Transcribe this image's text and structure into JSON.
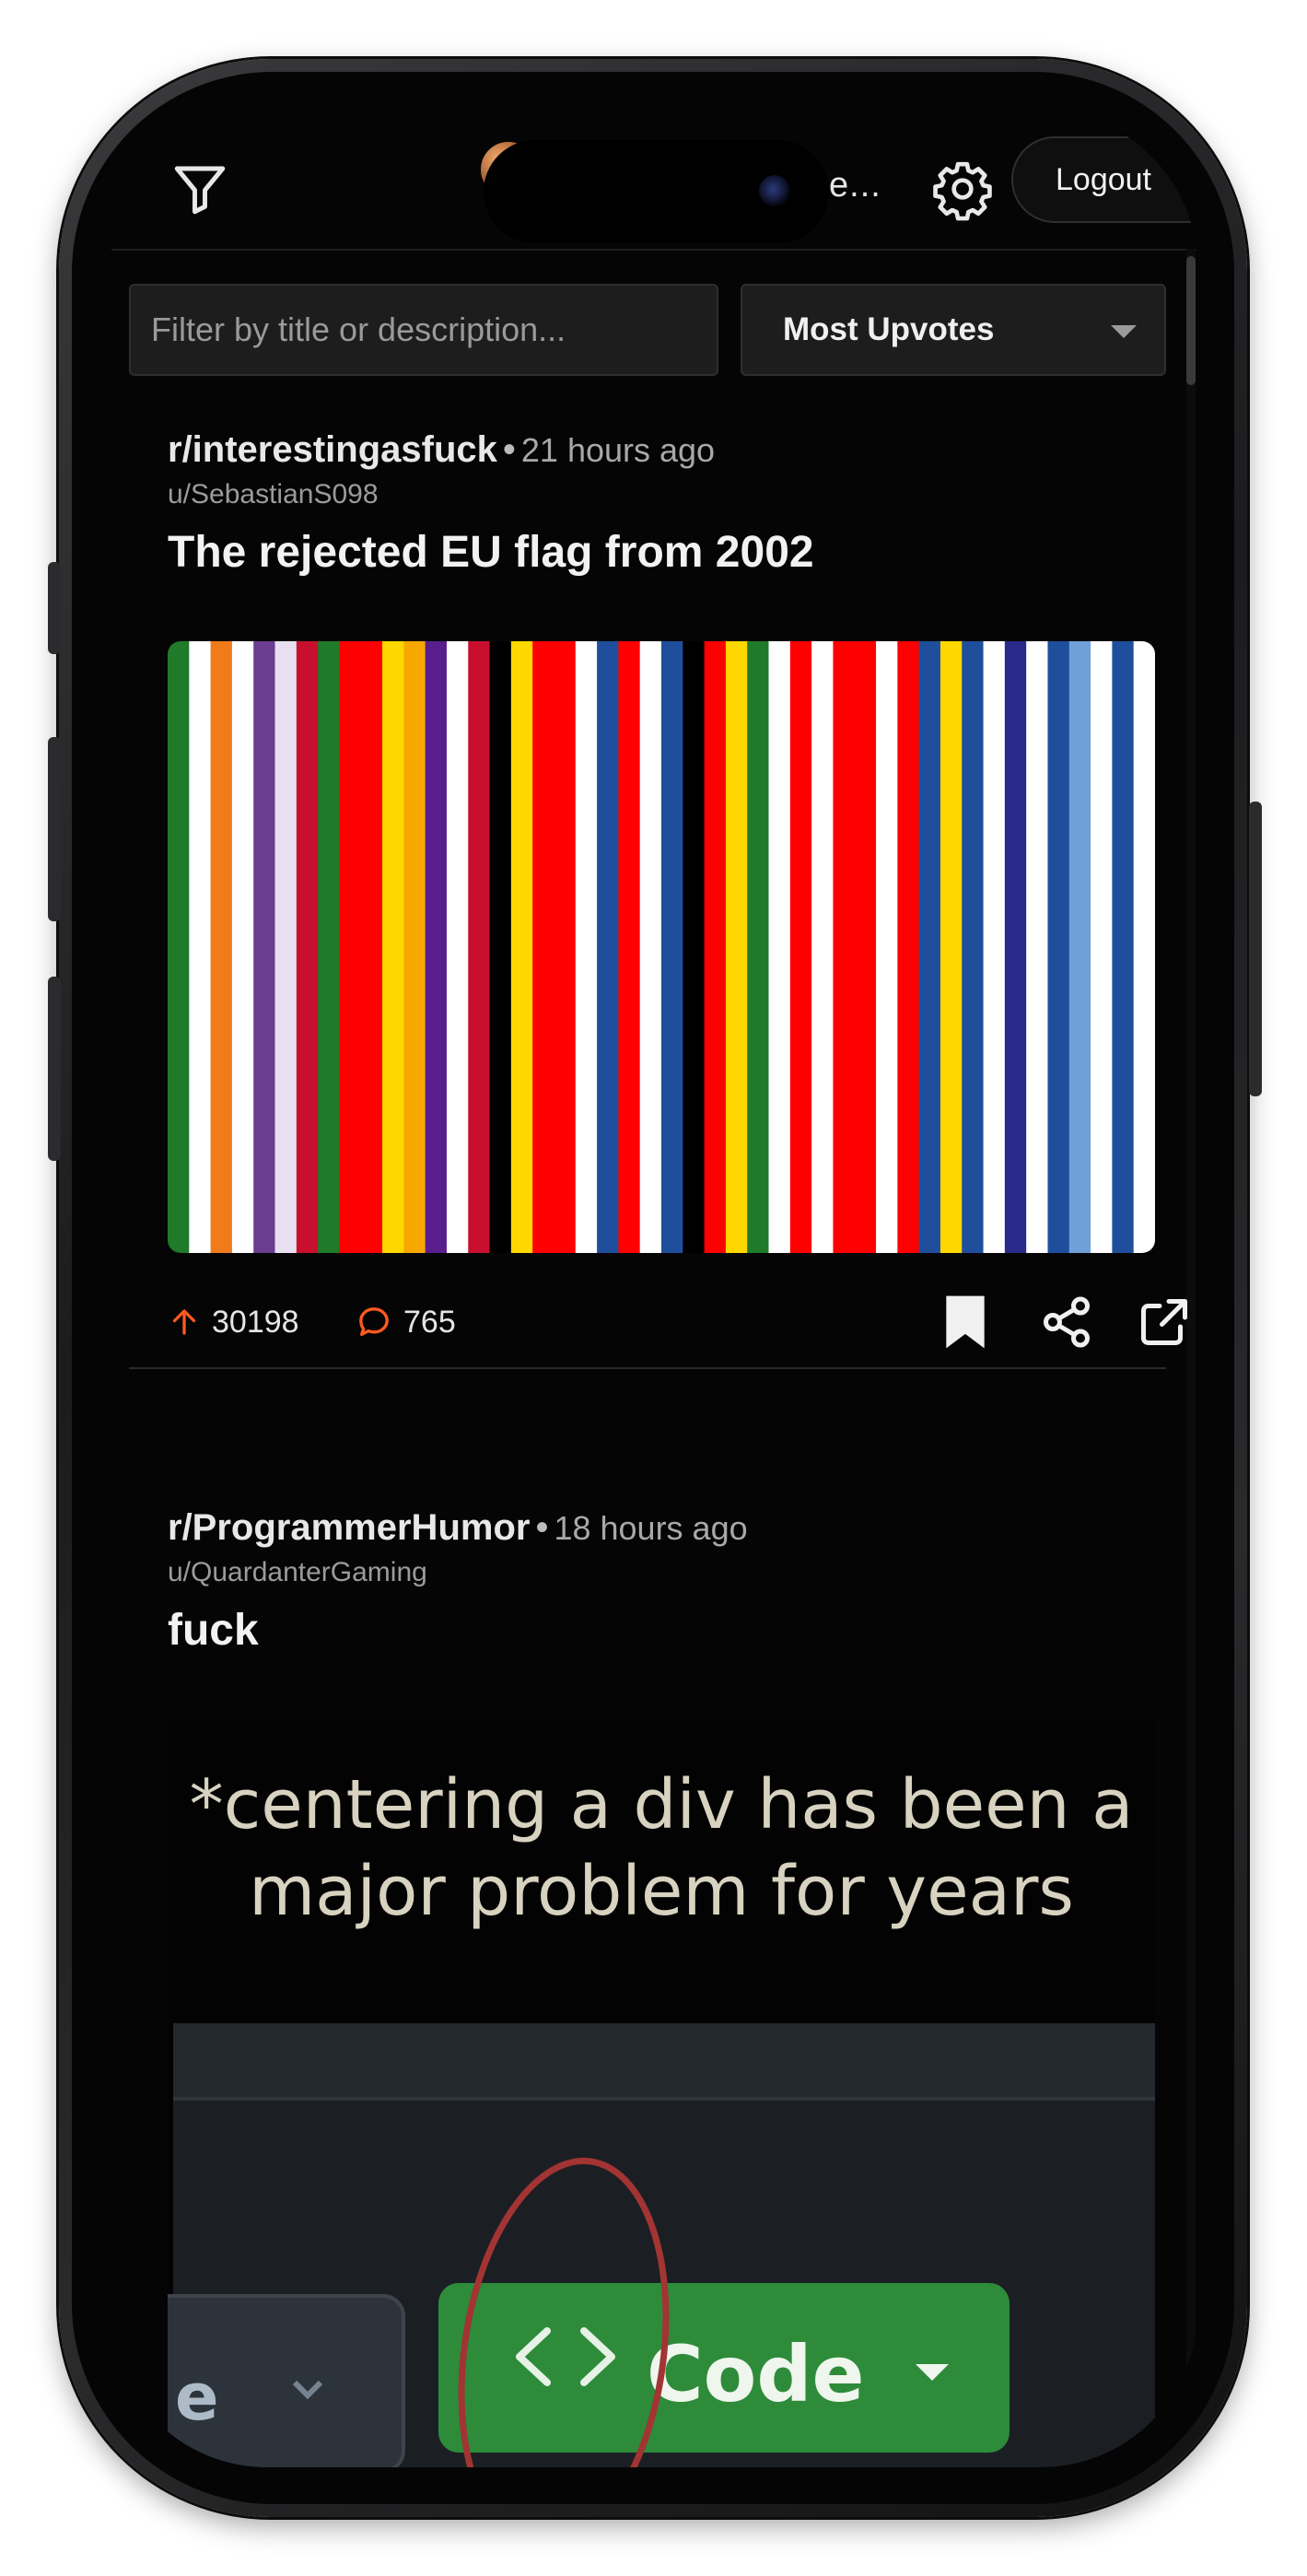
{
  "header": {
    "title_truncated": "e...",
    "logout_label": "Logout"
  },
  "controls": {
    "filter_placeholder": "Filter by title or description...",
    "sort_value": "Most Upvotes"
  },
  "posts": [
    {
      "subreddit": "r/interestingasfuck",
      "time": "21 hours ago",
      "author": "u/SebastianS098",
      "title": "The rejected EU flag from 2002",
      "upvotes": "30198",
      "comments": "765",
      "media": "striped-flag-image"
    },
    {
      "subreddit": "r/ProgrammerHumor",
      "time": "18 hours ago",
      "author": "u/QuardanterGaming",
      "title": "fuck",
      "media": "meme-image",
      "meme": {
        "caption_line1": "*centering a div has been a",
        "caption_line2": "major problem for years",
        "left_button_text": "e",
        "code_button_text": "Code"
      }
    }
  ],
  "colors": {
    "background": "#050505",
    "accent_orange": "#ff5a1f",
    "code_green": "#2e8b3a"
  }
}
